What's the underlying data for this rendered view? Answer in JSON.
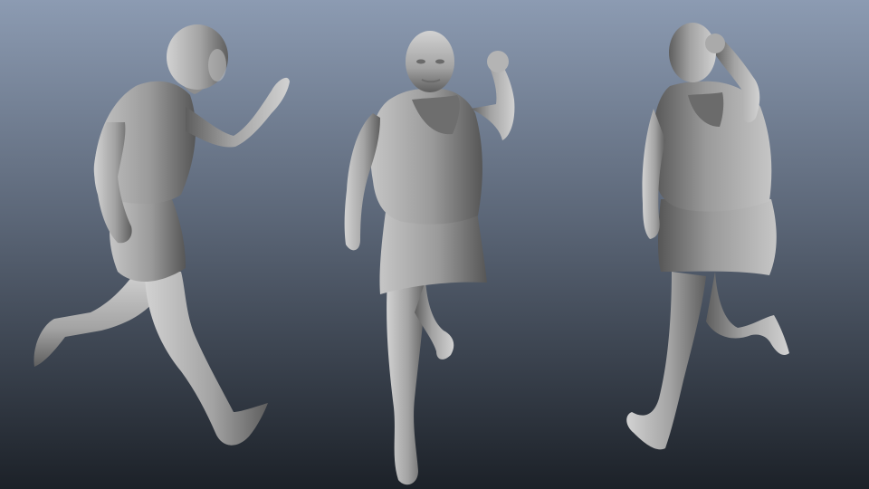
{
  "scene": {
    "background_top": "#8c9bb2",
    "background_bottom": "#1c2128",
    "skin_highlight": "#d2d2d2",
    "skin_base": "#a3a3a3",
    "skin_shadow": "#5e5e5e",
    "cloth_highlight": "#c6c6c6",
    "cloth_base": "#9a9a9a",
    "cloth_shadow": "#565656"
  },
  "figures": [
    {
      "view": "side-left",
      "pose": "running",
      "icon": "figure-side-view-icon"
    },
    {
      "view": "front",
      "pose": "running",
      "icon": "figure-front-view-icon"
    },
    {
      "view": "side-right",
      "pose": "running",
      "icon": "figure-three-quarter-view-icon"
    }
  ]
}
